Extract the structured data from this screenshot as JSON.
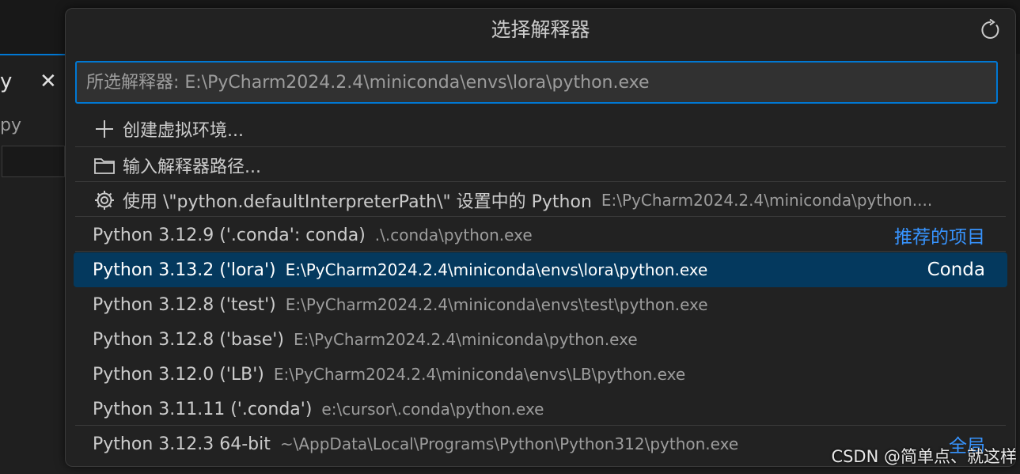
{
  "background": {
    "tab_text": "y",
    "tab_close": "✕",
    "sub_text": "py"
  },
  "quickpick": {
    "title": "选择解释器",
    "refresh_icon": "refresh-icon",
    "input": {
      "placeholder": "所选解释器: E:\\PyCharm2024.2.4\\miniconda\\envs\\lora\\python.exe",
      "value": ""
    },
    "actions": [
      {
        "icon": "plus-icon",
        "label": "创建虚拟环境..."
      },
      {
        "icon": "folder-icon",
        "label": "输入解释器路径..."
      },
      {
        "icon": "gear-icon",
        "label": "使用 \\\"python.defaultInterpreterPath\\\" 设置中的 Python",
        "desc": "E:\\PyCharm2024.2.4\\miniconda\\python...."
      }
    ],
    "interpreters": [
      {
        "label": "Python 3.12.9 ('.conda': conda)",
        "desc": ".\\.conda\\python.exe",
        "tag": "推荐的项目"
      },
      {
        "label": "Python 3.13.2 ('lora')",
        "desc": "E:\\PyCharm2024.2.4\\miniconda\\envs\\lora\\python.exe",
        "tag": "Conda",
        "selected": true
      },
      {
        "label": "Python 3.12.8 ('test')",
        "desc": "E:\\PyCharm2024.2.4\\miniconda\\envs\\test\\python.exe"
      },
      {
        "label": "Python 3.12.8 ('base')",
        "desc": "E:\\PyCharm2024.2.4\\miniconda\\python.exe"
      },
      {
        "label": "Python 3.12.0 ('LB')",
        "desc": "E:\\PyCharm2024.2.4\\miniconda\\envs\\LB\\python.exe"
      },
      {
        "label": "Python 3.11.11 ('.conda')",
        "desc": "e:\\cursor\\.conda\\python.exe"
      },
      {
        "label": "Python 3.12.3 64-bit",
        "desc": "~\\AppData\\Local\\Programs\\Python\\Python312\\python.exe",
        "tag": "全局"
      }
    ]
  },
  "watermark": "CSDN @简单点、就这样",
  "colors": {
    "accent": "#0078d4",
    "selection": "#04395e",
    "link": "#3794ff"
  }
}
